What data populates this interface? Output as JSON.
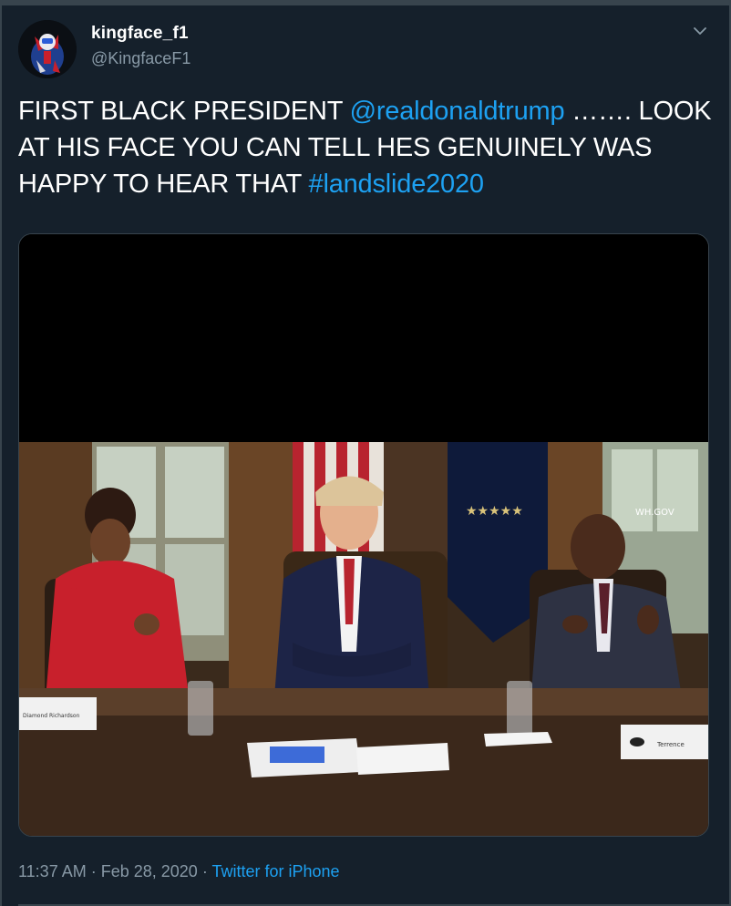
{
  "tweet": {
    "display_name": "kingface_f1",
    "handle": "@KingfaceF1",
    "avatar_icon": "avatar-image",
    "menu_icon": "chevron-down-icon",
    "text_parts": {
      "t1": "FIRST BLACK PRESIDENT ",
      "mention": "@realdonaldtrump",
      "t2": " ……. LOOK AT HIS FACE YOU CAN TELL HES GENUINELY WAS HAPPY TO HEAR THAT ",
      "hashtag": "#landslide2020"
    },
    "media": {
      "kind": "video",
      "watermark": "WH.GOV",
      "name_card_left": "Diamond Richardson",
      "name_card_right": "Terrence"
    },
    "time": "11:37 AM",
    "separator": " · ",
    "date": "Feb 28, 2020",
    "source": "Twitter for iPhone"
  },
  "colors": {
    "background": "#15202b",
    "link": "#1da1f2",
    "secondary_text": "#8899a6",
    "border": "#38444d"
  }
}
